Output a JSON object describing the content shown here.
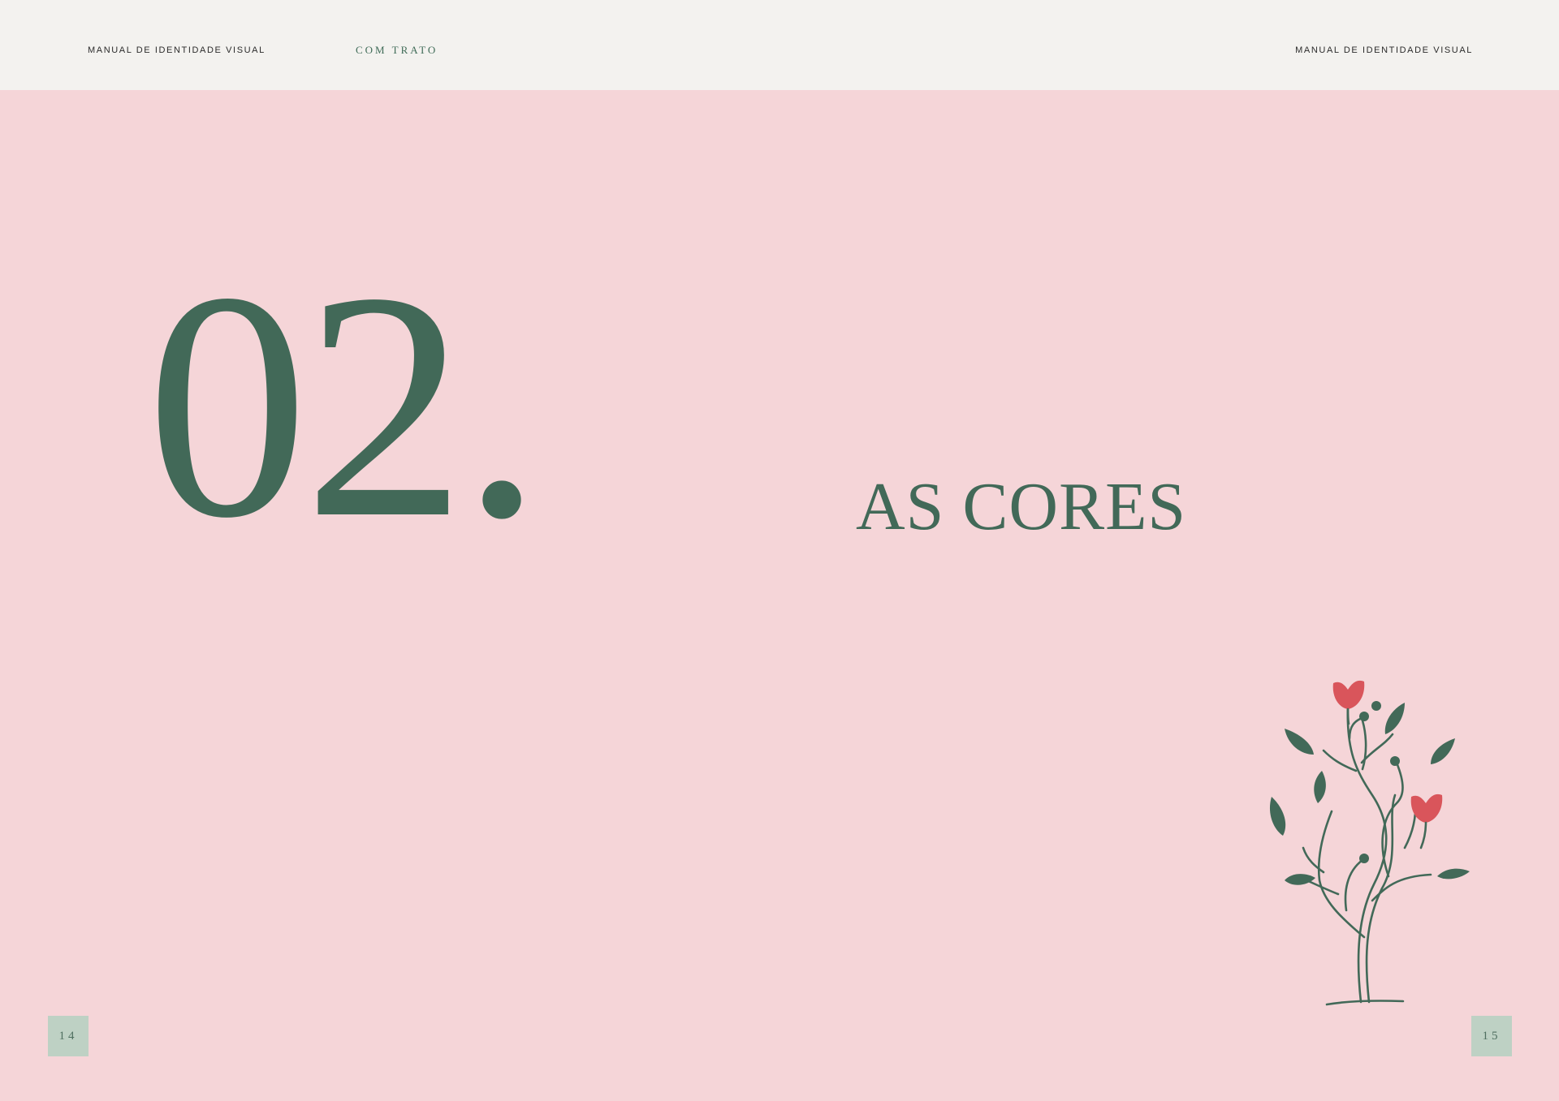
{
  "header": {
    "left_label": "MANUAL DE IDENTIDADE VISUAL",
    "brand": "COM TRATO",
    "right_label": "MANUAL DE IDENTIDADE VISUAL"
  },
  "chapter": {
    "number": "02.",
    "title": "AS CORES"
  },
  "pages": {
    "left": "14",
    "right": "15"
  },
  "illustration": {
    "icon": "flowering-plant-icon",
    "stem_color": "#426958",
    "flower_color": "#d9555b"
  },
  "colors": {
    "background": "#f5d5d8",
    "header_bg": "#f3f2ef",
    "accent_green": "#426958",
    "badge_bg": "#bed1c4"
  }
}
